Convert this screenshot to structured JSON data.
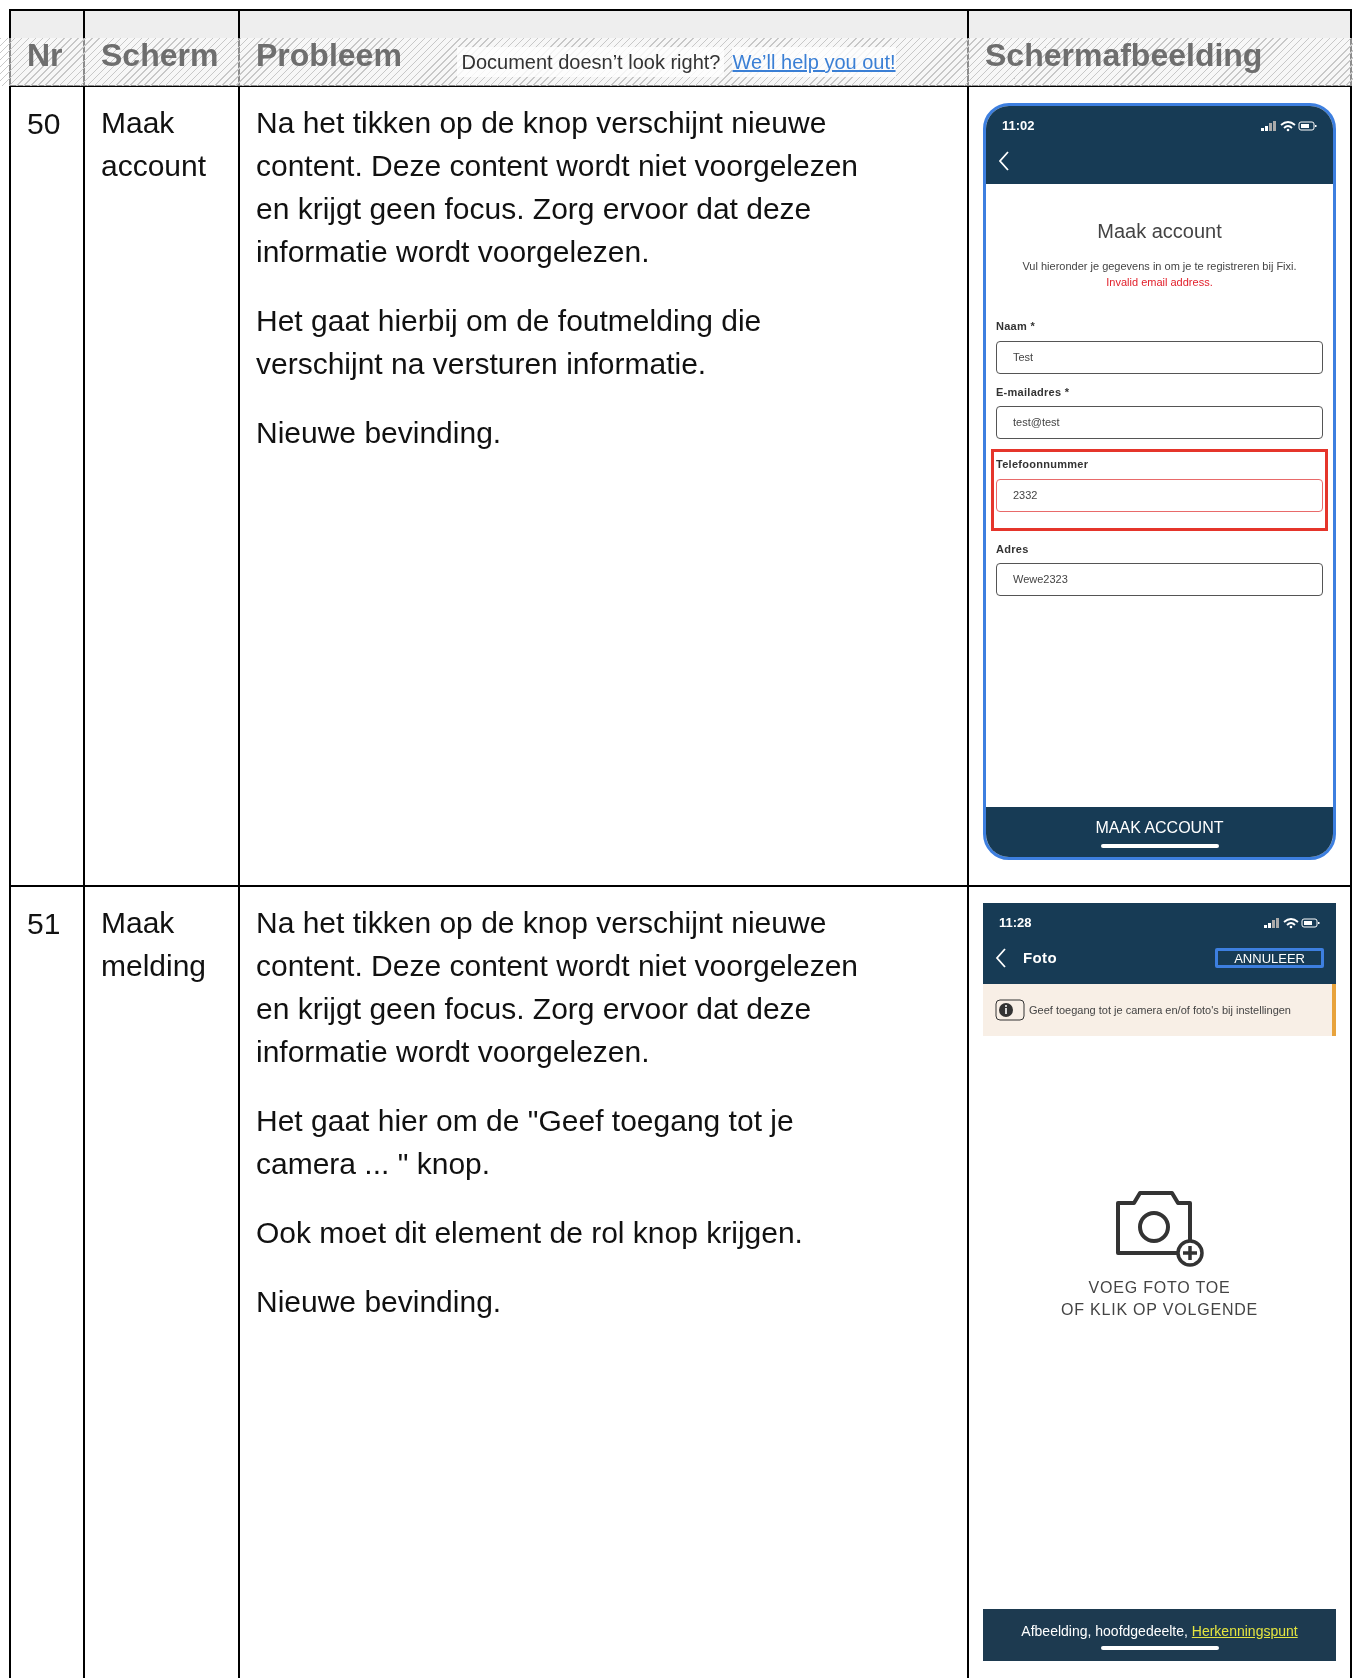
{
  "banner": {
    "text": "Document doesn’t look right?",
    "link": "We’ll help you out!"
  },
  "table": {
    "columns": [
      "Nr",
      "Scherm",
      "Probleem",
      "Schermafbeelding"
    ],
    "rows": [
      {
        "nr": "50",
        "screen": "Maak account",
        "paragraphs": [
          "Na het tikken op de knop verschijnt nieuwe content. Deze content wordt niet voorgelezen en krijgt geen focus. Zorg ervoor dat deze informatie wordt voorgelezen.",
          "Het gaat hierbij om de foutmelding die verschijnt na versturen informatie.",
          "Nieuwe bevinding."
        ],
        "screenshot": {
          "kind": "form",
          "focused": true,
          "time": "11:02",
          "title": "Maak account",
          "intro": "Vul hieronder je gegevens in om je te registreren bij Fixi.",
          "error": "Invalid email address.",
          "fields": [
            {
              "label": "Naam *",
              "value": "Test",
              "highlighted": false
            },
            {
              "label": "E-mailadres *",
              "value": "test@test",
              "highlighted": false
            },
            {
              "label": "Telefoonnummer",
              "value": "2332",
              "highlighted": true
            },
            {
              "label": "Adres",
              "value": "Wewe2323",
              "highlighted": false
            }
          ],
          "button": "MAAK ACCOUNT"
        }
      },
      {
        "nr": "51",
        "screen": "Maak melding",
        "paragraphs": [
          "Na het tikken op de knop verschijnt nieuwe content. Deze content wordt niet voorgelezen en krijgt geen focus. Zorg ervoor dat deze informatie wordt voorgelezen.",
          "Het gaat hier om de \"Geef toegang tot je camera ... \" knop.",
          "Ook moet dit element de rol knop krijgen.",
          "Nieuwe bevinding."
        ],
        "screenshot": {
          "kind": "photo",
          "time": "11:28",
          "nav_title": "Foto",
          "cancel": {
            "label": "ANNULEER",
            "focused": true
          },
          "notice": "Geef toegang tot je camera en/of foto's bij instellingen",
          "empty_lines": [
            "VOEG FOTO TOE",
            "OF KLIK OP VOLGENDE"
          ],
          "caption": "Afbeelding, hoofdgedeelte, ",
          "caption_link": "Herkenningspunt"
        }
      }
    ]
  }
}
